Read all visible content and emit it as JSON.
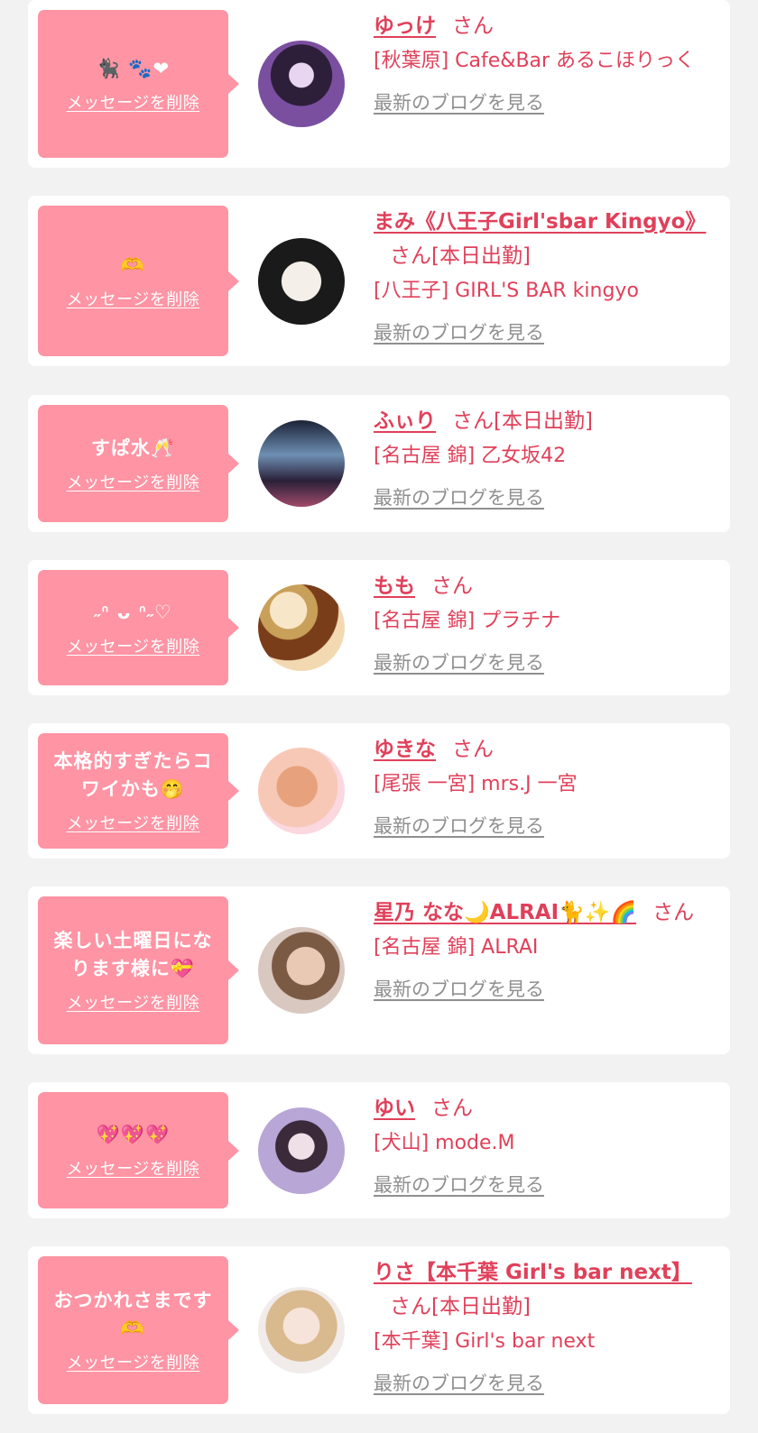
{
  "delete_label": "メッセージを削除",
  "blog_label": "最新のブログを見る",
  "honorific": "さん",
  "colors": {
    "page_bg": "#f2f2f2",
    "card_bg": "#ffffff",
    "bubble_bg": "#fe94a4",
    "accent": "#e0405a",
    "blog_link": "#8f8f8f"
  },
  "entries": [
    {
      "message": "🐈‍⬛ 🐾❤",
      "name": "ゆっけ",
      "status": "",
      "shop": "[秋葉原] Cafe&Bar あるこほりっく"
    },
    {
      "message": "🫶",
      "name": "まみ《八王子Girl'sbar Kingyo》",
      "status": "[本日出勤]",
      "shop": "[八王子] GIRL'S BAR kingyo"
    },
    {
      "message": "すぱ水🥂",
      "name": "ふぃり",
      "status": "[本日出勤]",
      "shop": "[名古屋 錦] 乙女坂42"
    },
    {
      "message": "˶ᐢ ᴗ ᐢ˶♡",
      "name": "もも",
      "status": "",
      "shop": "[名古屋 錦] プラチナ"
    },
    {
      "message": "本格的すぎたらコワイかも🤭",
      "name": "ゆきな",
      "status": "",
      "shop": "[尾張 一宮] mrs.J 一宮"
    },
    {
      "message": "楽しい土曜日になります様に💝",
      "name": "星乃 なな🌙ALRAI🐈✨🌈",
      "status": "",
      "shop": "[名古屋 錦] ALRAI"
    },
    {
      "message": "💖💖💖",
      "name": "ゆい",
      "status": "",
      "shop": "[犬山] mode.M"
    },
    {
      "message": "おつかれさまです🫶",
      "name": "りさ【本千葉 Girl's bar next】",
      "status": "[本日出勤]",
      "shop": "[本千葉] Girl's bar next"
    }
  ]
}
